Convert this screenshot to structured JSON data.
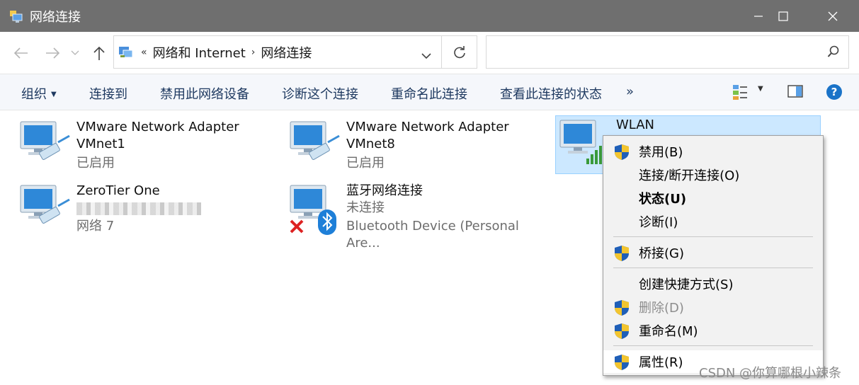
{
  "window": {
    "title": "网络连接"
  },
  "address": {
    "overflow": "«",
    "crumbs": [
      "网络和 Internet",
      "网络连接"
    ],
    "search_placeholder": ""
  },
  "toolbar": {
    "organize": "组织",
    "connect_to": "连接到",
    "disable": "禁用此网络设备",
    "diagnose": "诊断这个连接",
    "rename": "重命名此连接",
    "view_status": "查看此连接的状态",
    "more": "»"
  },
  "connections": [
    {
      "name": "VMware Network Adapter",
      "name2": "VMnet1",
      "status": "已启用"
    },
    {
      "name": "VMware Network Adapter",
      "name2": "VMnet8",
      "status": "已启用"
    },
    {
      "name": "WLAN",
      "name2": "",
      "status": ""
    },
    {
      "name": "ZeroTier One",
      "name2": "",
      "status": "网络 7"
    },
    {
      "name": "蓝牙网络连接",
      "name2": "未连接",
      "status": "Bluetooth Device (Personal Are..."
    }
  ],
  "context_menu": {
    "items": [
      {
        "label": "禁用(B)",
        "shield": true
      },
      {
        "label": "连接/断开连接(O)",
        "shield": false
      },
      {
        "label": "状态(U)",
        "shield": false,
        "bold": true
      },
      {
        "label": "诊断(I)",
        "shield": false
      },
      {
        "label": "桥接(G)",
        "shield": true
      },
      {
        "label": "创建快捷方式(S)",
        "shield": false
      },
      {
        "label": "删除(D)",
        "shield": true,
        "disabled": true
      },
      {
        "label": "重命名(M)",
        "shield": true
      },
      {
        "label": "属性(R)",
        "shield": true
      }
    ]
  },
  "watermark": "CSDN @你算哪根小辣条",
  "colors": {
    "titlebar": "#6f6f6f",
    "selection": "#cce8ff",
    "toolbar_text": "#1e3960",
    "help": "#1a73c8"
  }
}
